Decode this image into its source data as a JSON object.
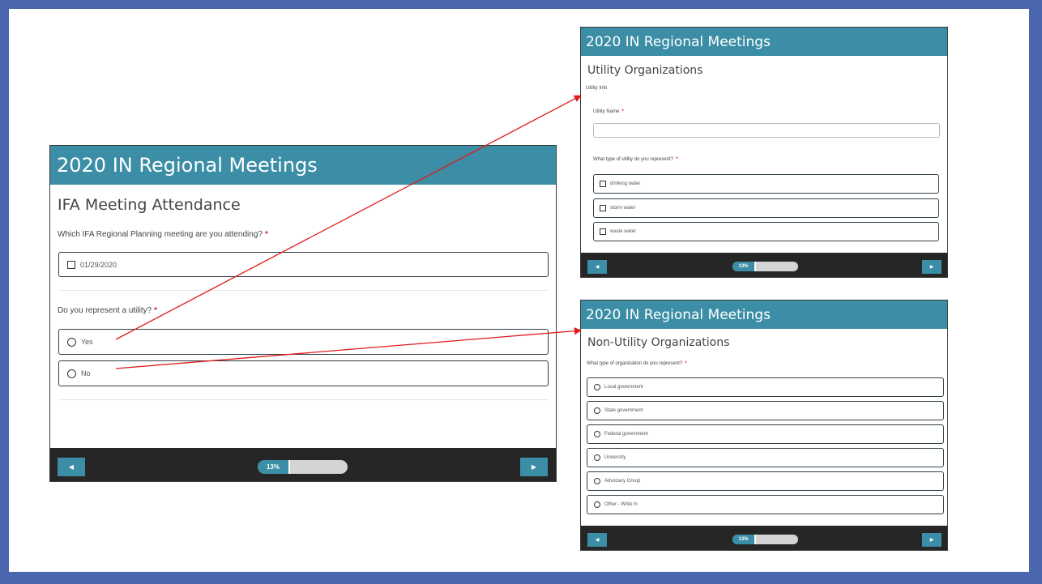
{
  "colors": {
    "frame": "#4a66ad",
    "header": "#3b8ea5",
    "footer": "#262626",
    "required": "#d8262e",
    "arrow": "#e01b1b"
  },
  "main": {
    "header_title": "2020 IN Regional Meetings",
    "page_title": "IFA Meeting Attendance",
    "q1": "Which IFA Regional Planning meeting are you attending?",
    "q1_option": "01/29/2020",
    "q2": "Do you represent a utility?",
    "q2_options": [
      "Yes",
      "No"
    ],
    "progress_label": "13%",
    "progress": 0.13
  },
  "utility": {
    "header_title": "2020 IN Regional Meetings",
    "page_title": "Utility Organizations",
    "section_label": "Utility Info",
    "name_label": "Utility Name",
    "type_question": "What type of utility do you represent?",
    "type_options": [
      "drinking water",
      "storm water",
      "waste water"
    ],
    "progress_label": "13%",
    "progress": 0.13
  },
  "nonutility": {
    "header_title": "2020 IN Regional Meetings",
    "page_title": "Non-Utility Organizations",
    "type_question": "What type of organization do you represent?",
    "type_options": [
      "Local government",
      "State government",
      "Federal government",
      "University",
      "Advocacy Group",
      "Other - Write In"
    ],
    "progress_label": "13%",
    "progress": 0.13
  },
  "icons": {
    "prev": "chevron-left-icon",
    "next": "chevron-right-icon"
  }
}
